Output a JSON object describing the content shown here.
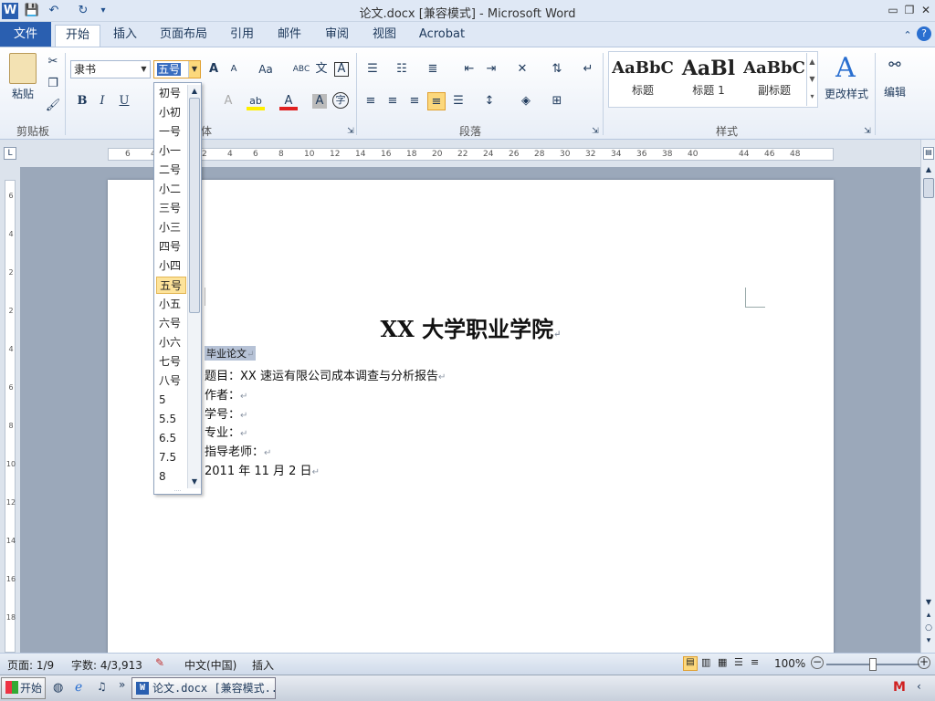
{
  "window": {
    "title": "论文.docx [兼容模式] - Microsoft Word",
    "minimize": "▭",
    "restore": "❐",
    "close": "✕"
  },
  "quick_access": {
    "word_icon": "W",
    "save_icon": "💾",
    "undo_icon": "↶",
    "redo_icon": "↻",
    "customize_icon": "▾"
  },
  "tabs": [
    {
      "label": "文件"
    },
    {
      "label": "开始"
    },
    {
      "label": "插入"
    },
    {
      "label": "页面布局"
    },
    {
      "label": "引用"
    },
    {
      "label": "邮件"
    },
    {
      "label": "审阅"
    },
    {
      "label": "视图"
    },
    {
      "label": "Acrobat"
    }
  ],
  "ribbon": {
    "clipboard": {
      "paste_label": "粘贴",
      "group_label": "剪贴板"
    },
    "font": {
      "font_name": "隶书",
      "font_size": "五号",
      "group_label": "体",
      "bold": "B",
      "italic": "I",
      "underline": "U",
      "grow": "A",
      "shrink": "A",
      "change_case": "Aa",
      "clear": "ABC",
      "phonetic": "文",
      "border_char": "A",
      "highlight": "ab",
      "font_color": "A",
      "shading": "A",
      "enclose": "字"
    },
    "paragraph": {
      "group_label": "段落"
    },
    "styles": {
      "group_label": "样式",
      "items": [
        {
          "sample": "AaBbC",
          "label": "标题"
        },
        {
          "sample": "AaBl",
          "label": "标题 1"
        },
        {
          "sample": "AaBbC",
          "label": "副标题"
        }
      ],
      "change_styles": "更改样式"
    },
    "editing": {
      "label": "编辑"
    }
  },
  "ruler": {
    "h_ticks": [
      "6",
      "4",
      "2",
      "2",
      "4",
      "6",
      "8",
      "10",
      "12",
      "14",
      "16",
      "18",
      "20",
      "22",
      "24",
      "26",
      "28",
      "30",
      "32",
      "34",
      "36",
      "38",
      "40",
      "",
      "44",
      "46",
      "48"
    ],
    "v_ticks": [
      "6",
      "4",
      "2",
      "2",
      "4",
      "6",
      "8",
      "10",
      "12",
      "14",
      "16",
      "18"
    ]
  },
  "font_size_dropdown": {
    "selected": "五号",
    "options": [
      "初号",
      "小初",
      "一号",
      "小一",
      "二号",
      "小二",
      "三号",
      "小三",
      "四号",
      "小四",
      "五号",
      "小五",
      "六号",
      "小六",
      "七号",
      "八号",
      "5",
      "5.5",
      "6.5",
      "7.5",
      "8"
    ]
  },
  "document": {
    "title": "XX 大学职业学院",
    "selected_line": "毕业论文",
    "lines": [
      "题目：XX 速运有限公司成本调查与分析报告",
      "作者：",
      "学号：",
      "专业：",
      "指导老师：",
      "2011 年 11 月 2 日"
    ],
    "paragraph_mark": "↵"
  },
  "status_bar": {
    "page": "页面: 1/9",
    "words": "字数: 4/3,913",
    "language": "中文(中国)",
    "mode": "插入",
    "zoom": "100%",
    "zoom_level": 1.0
  },
  "taskbar": {
    "start": "开始",
    "task": "论文.docx [兼容模式..."
  }
}
